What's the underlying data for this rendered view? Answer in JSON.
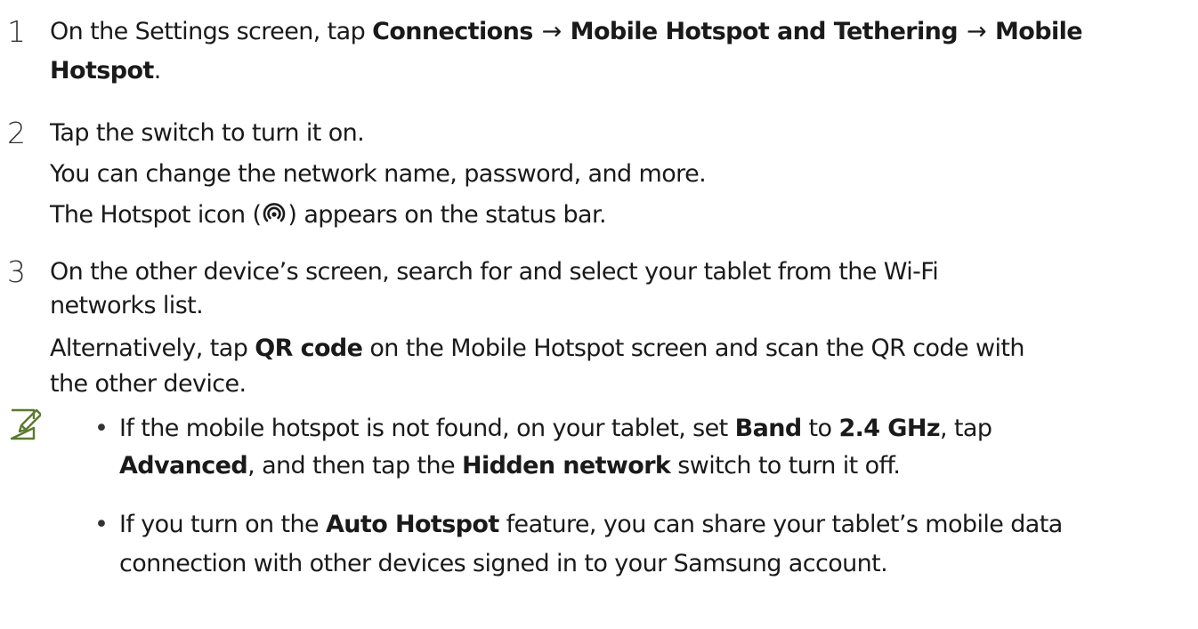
{
  "steps": [
    {
      "number": "1",
      "l1": {
        "t1": "On the Settings screen, tap ",
        "b1": "Connections",
        "arrow1": "→",
        "b2": "Mobile Hotspot and Tethering",
        "arrow2": "→",
        "b3": "Mobile"
      },
      "l2": {
        "b1": "Hotspot",
        "t1": "."
      }
    },
    {
      "number": "2",
      "l1": "Tap the switch to turn it on.",
      "l2": "You can change the network name, password, and more.",
      "l3": {
        "t1": "The Hotspot icon (",
        "icon": "hotspot-icon",
        "t2": ") appears on the status bar."
      }
    },
    {
      "number": "3",
      "l1": "On the other device’s screen, search for and select your tablet from the Wi-Fi",
      "l2": "networks list.",
      "l3": {
        "t1": "Alternatively, tap ",
        "b1": "QR code",
        "t2": " on the Mobile Hotspot screen and scan the QR code with"
      },
      "l4": "the other device."
    }
  ],
  "note": {
    "icon": "note-pencil-icon",
    "accent": "#5b7a2e",
    "bullets": [
      {
        "l1": {
          "t1": "If the mobile hotspot is not found, on your tablet, set ",
          "b1": "Band",
          "t2": " to ",
          "b2": "2.4 GHz",
          "t3": ", tap"
        },
        "l2": {
          "b1": "Advanced",
          "t1": ", and then tap the ",
          "b2": "Hidden network",
          "t2": " switch to turn it off."
        }
      },
      {
        "l1": {
          "t1": "If you turn on the ",
          "b1": "Auto Hotspot",
          "t2": " feature, you can share your tablet’s mobile data"
        },
        "l2": "connection with other devices signed in to your Samsung account."
      }
    ]
  }
}
